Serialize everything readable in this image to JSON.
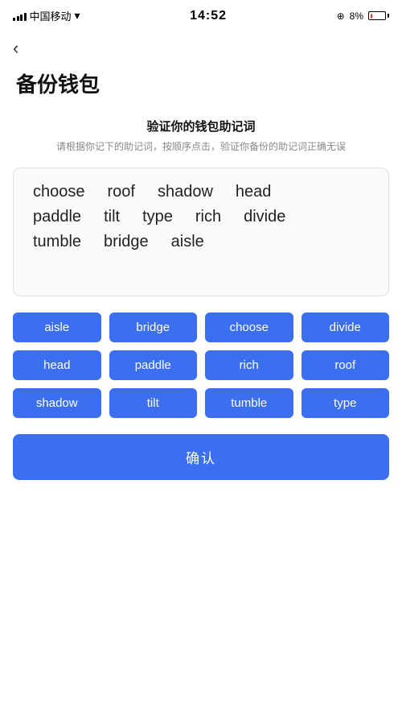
{
  "statusBar": {
    "carrier": "中国移动",
    "time": "14:52",
    "battery": "8%"
  },
  "page": {
    "back_label": "‹",
    "title": "备份钱包",
    "subtitle": "验证你的钱包助记词",
    "description": "请根据你记下的助记词，按顺序点击，验证你备份的助记词正确无误",
    "confirm_label": "确认"
  },
  "displayWords": [
    [
      "choose",
      "roof",
      "shadow",
      "head"
    ],
    [
      "paddle",
      "tilt",
      "type",
      "rich",
      "divide"
    ],
    [
      "tumble",
      "bridge",
      "aisle"
    ]
  ],
  "wordButtons": [
    "aisle",
    "bridge",
    "choose",
    "divide",
    "head",
    "paddle",
    "rich",
    "roof",
    "shadow",
    "tilt",
    "tumble",
    "type"
  ]
}
